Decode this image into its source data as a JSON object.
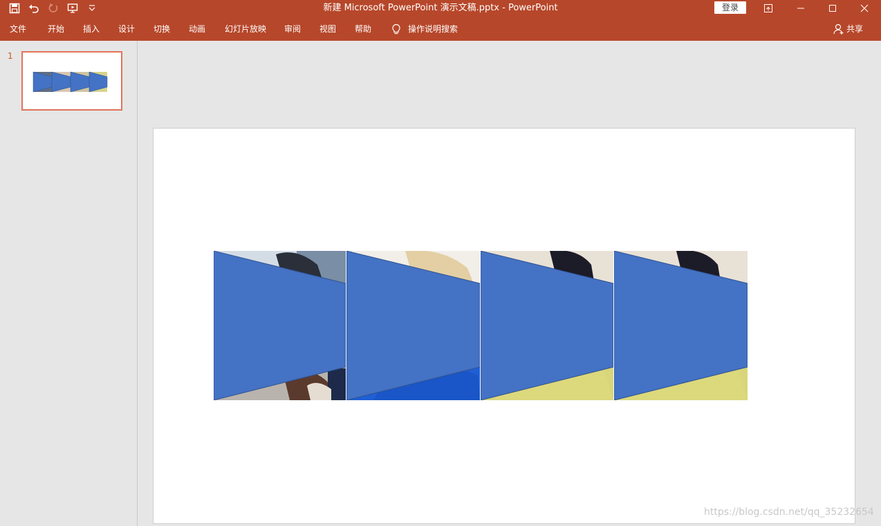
{
  "app": {
    "title": "新建 Microsoft PowerPoint 演示文稿.pptx  -  PowerPoint",
    "login_label": "登录"
  },
  "ribbon": {
    "tabs": [
      {
        "label": "文件"
      },
      {
        "label": "开始"
      },
      {
        "label": "插入"
      },
      {
        "label": "设计"
      },
      {
        "label": "切换"
      },
      {
        "label": "动画"
      },
      {
        "label": "幻灯片放映"
      },
      {
        "label": "审阅"
      },
      {
        "label": "视图"
      },
      {
        "label": "帮助"
      }
    ],
    "tell_me": "操作说明搜索",
    "share": "共享"
  },
  "slides_pane": {
    "slide_number": "1"
  },
  "slide": {
    "shape_color": "#4472c4",
    "shape_outline": "#2f528f"
  },
  "watermark": "https://blog.csdn.net/qq_35232654"
}
